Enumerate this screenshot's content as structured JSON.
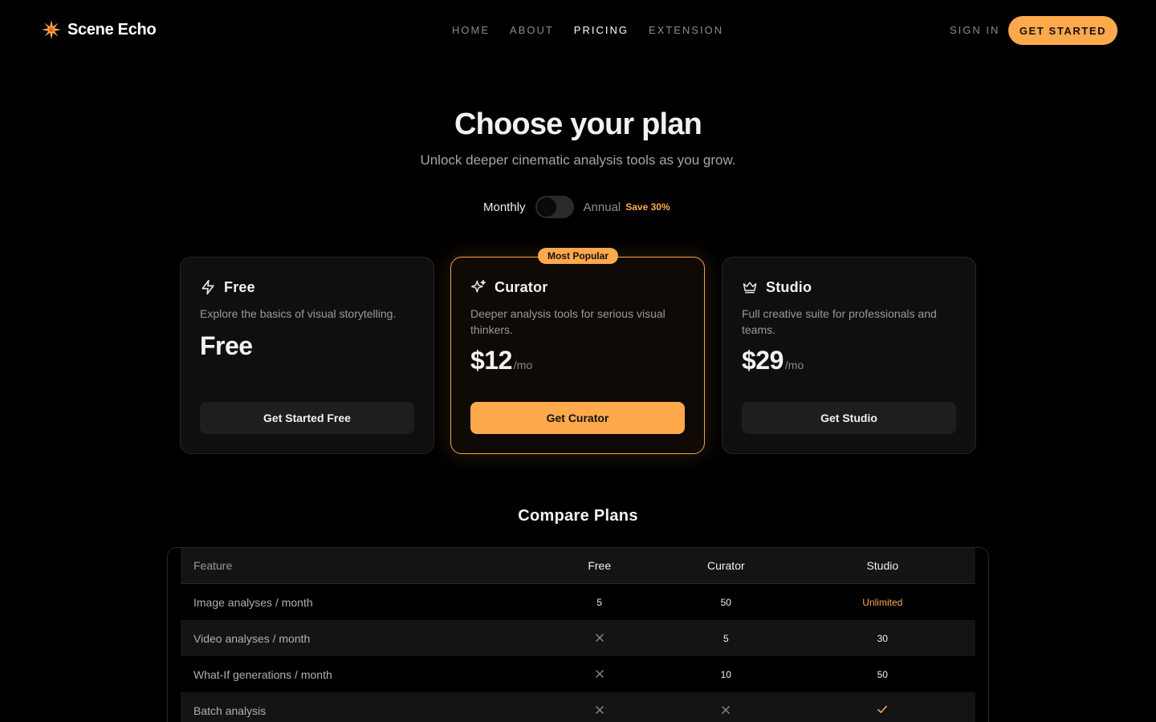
{
  "nav": {
    "brand": "Scene Echo",
    "links": [
      {
        "label": "HOME",
        "active": false
      },
      {
        "label": "ABOUT",
        "active": false
      },
      {
        "label": "PRICING",
        "active": true
      },
      {
        "label": "EXTENSION",
        "active": false
      }
    ],
    "sign_in": "SIGN IN",
    "cta": "GET STARTED"
  },
  "hero": {
    "title": "Choose your plan",
    "subtitle": "Unlock deeper cinematic analysis tools as you grow."
  },
  "billing": {
    "monthly": "Monthly",
    "annual": "Annual",
    "save": "Save 30%",
    "annual_selected": false
  },
  "plans": [
    {
      "name": "Free",
      "icon": "lightning-icon",
      "description": "Explore the basics of visual storytelling.",
      "price": "Free",
      "per": "",
      "button": "Get Started Free",
      "featured": false
    },
    {
      "name": "Curator",
      "icon": "sparkles-icon",
      "description": "Deeper analysis tools for serious visual thinkers.",
      "price": "$12",
      "per": "/mo",
      "button": "Get Curator",
      "featured": true,
      "badge": "Most Popular"
    },
    {
      "name": "Studio",
      "icon": "crown-icon",
      "description": "Full creative suite for professionals and teams.",
      "price": "$29",
      "per": "/mo",
      "button": "Get Studio",
      "featured": false
    }
  ],
  "compare": {
    "title": "Compare Plans",
    "headers": [
      "Feature",
      "Free",
      "Curator",
      "Studio"
    ],
    "rows": [
      {
        "feature": "Image analyses / month",
        "free": "5",
        "curator": "50",
        "studio": "Unlimited"
      },
      {
        "feature": "Video analyses / month",
        "free": "x",
        "curator": "5",
        "studio": "30"
      },
      {
        "feature": "What-If generations / month",
        "free": "x",
        "curator": "10",
        "studio": "50"
      },
      {
        "feature": "Batch analysis",
        "free": "x",
        "curator": "x",
        "studio": "check"
      }
    ]
  },
  "colors": {
    "accent": "#ffa94d",
    "background": "#000000",
    "card": "#0f0f0f",
    "muted_text": "#9a9a9a"
  }
}
